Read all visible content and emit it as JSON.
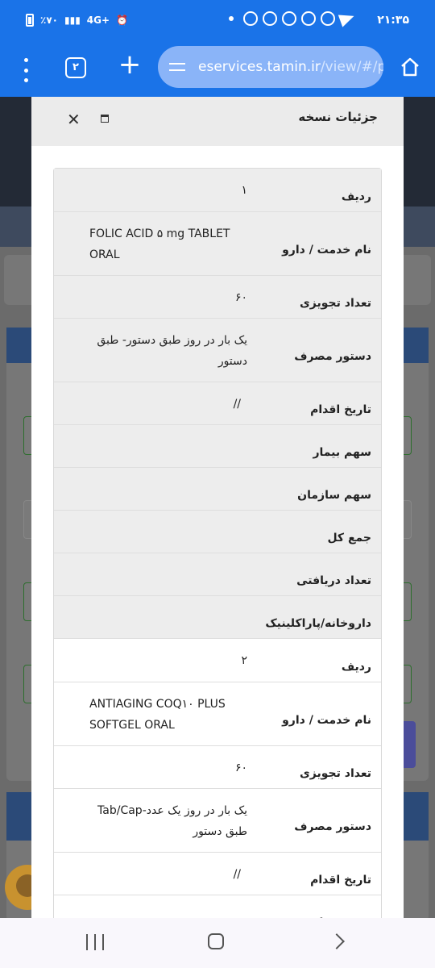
{
  "status_bar": {
    "time": "۲۱:۳۵",
    "battery": "٪۷۰",
    "network": "4G+"
  },
  "browser": {
    "tabs_count": "۲",
    "url_host": "eservices.tamin.ir",
    "url_path": "/view/#/pat",
    "icons": [
      "menu-dots-icon",
      "tabs-icon",
      "plus-icon",
      "tune-icon",
      "home-icon"
    ]
  },
  "modal": {
    "title": "جزئیات نسخه",
    "rows": [
      {
        "label": "ردیف",
        "value": "۱"
      },
      {
        "label": "نام خدمت / دارو",
        "value": "FOLIC ACID ۵ mg TABLET ORAL"
      },
      {
        "label": "تعداد تجویزی",
        "value": "۶۰"
      },
      {
        "label": "دستور مصرف",
        "value": "یک بار در روز طبق دستور- طبق دستور"
      },
      {
        "label": "تاریخ اقدام",
        "value": "//"
      },
      {
        "label": "سهم بیمار",
        "value": ""
      },
      {
        "label": "سهم سازمان",
        "value": ""
      },
      {
        "label": "جمع کل",
        "value": ""
      },
      {
        "label": "تعداد دریافتی",
        "value": ""
      },
      {
        "label": "داروخانه/پاراکلینیک",
        "value": ""
      },
      {
        "label": "ردیف",
        "value": "۲"
      },
      {
        "label": "نام خدمت / دارو",
        "value": "ANTIAGING COQ۱۰ PLUS SOFTGEL ORAL"
      },
      {
        "label": "تعداد تجویزی",
        "value": "۶۰"
      },
      {
        "label": "دستور مصرف",
        "value": "یک بار در روز یک عدد-Tab/Cap طبق دستور"
      },
      {
        "label": "تاریخ اقدام",
        "value": "//"
      },
      {
        "label": "سهم بیمار",
        "value": ""
      }
    ]
  }
}
